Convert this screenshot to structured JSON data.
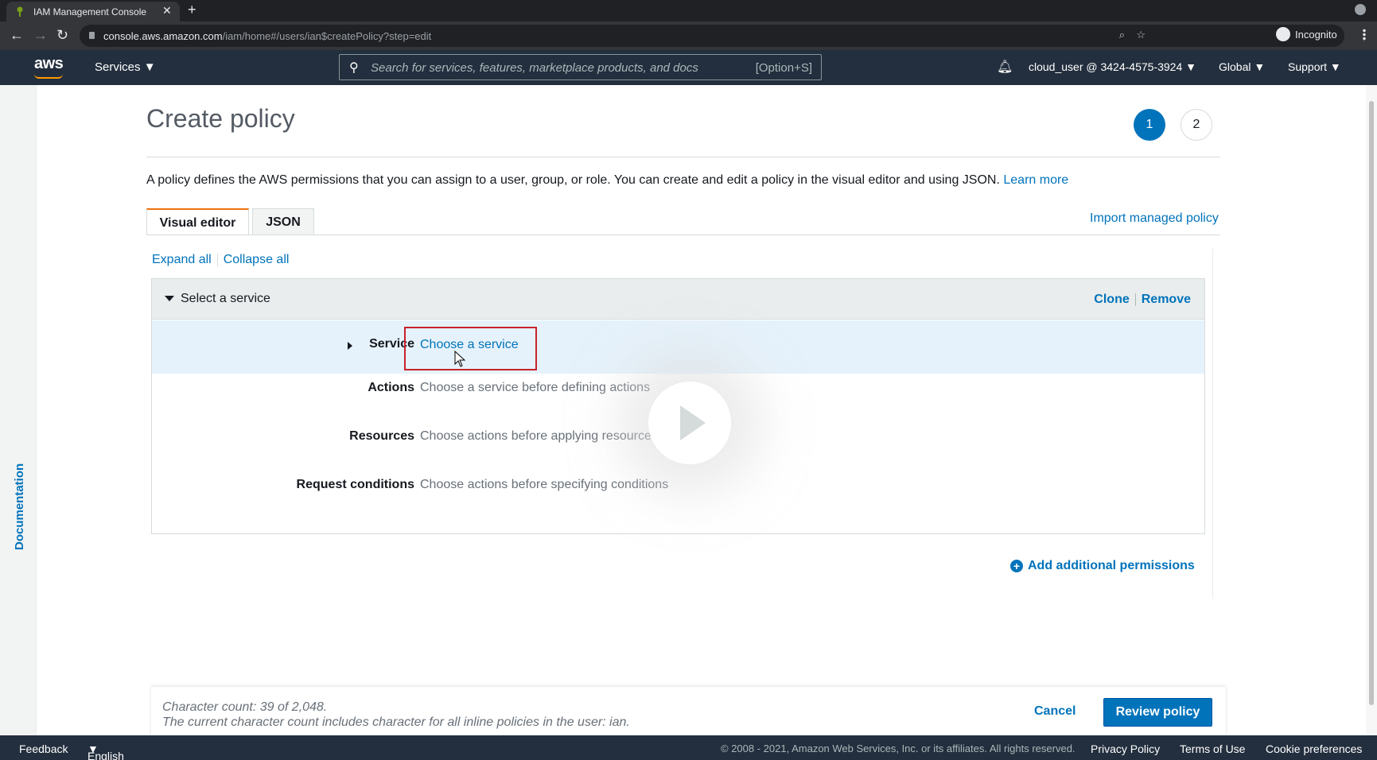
{
  "browser": {
    "tab_title": "IAM Management Console",
    "url_host": "console.aws.amazon.com",
    "url_path": "/iam/home#/users/ian$createPolicy?step=edit",
    "profile_label": "Incognito"
  },
  "aws_header": {
    "logo": "aws",
    "services_label": "Services",
    "search_placeholder": "Search for services, features, marketplace products, and docs",
    "search_shortcut": "[Option+S]",
    "account": "cloud_user @ 3424-4575-3924",
    "region": "Global",
    "support": "Support"
  },
  "doc_rail": {
    "label": "Documentation"
  },
  "page": {
    "title": "Create policy",
    "steps": [
      "1",
      "2"
    ],
    "intro": "A policy defines the AWS permissions that you can assign to a user, group, or role. You can create and edit a policy in the visual editor and using JSON.",
    "learn_more": "Learn more",
    "tabs": [
      "Visual editor",
      "JSON"
    ],
    "import_label": "Import managed policy",
    "expand_all": "Expand all",
    "collapse_all": "Collapse all"
  },
  "statement": {
    "header": "Select a service",
    "clone": "Clone",
    "remove": "Remove",
    "rows": [
      {
        "label": "Service",
        "value": "Choose a service"
      },
      {
        "label": "Actions",
        "value": "Choose a service before defining actions"
      },
      {
        "label": "Resources",
        "value": "Choose actions before applying resources"
      },
      {
        "label": "Request conditions",
        "value": "Choose actions before specifying conditions"
      }
    ]
  },
  "add_permissions": "Add additional permissions",
  "footer_bar": {
    "char_count": "Character count: 39 of 2,048.",
    "char_note": "The current character count includes character for all inline policies in the user: ian.",
    "cancel": "Cancel",
    "review": "Review policy"
  },
  "console_footer": {
    "feedback": "Feedback",
    "language": "English (US)",
    "copyright": "© 2008 - 2021, Amazon Web Services, Inc. or its affiliates. All rights reserved.",
    "privacy": "Privacy Policy",
    "terms": "Terms of Use",
    "cookies": "Cookie preferences"
  },
  "colors": {
    "aws_nav": "#232f3e",
    "link": "#0073bb",
    "accent_orange": "#ec7211",
    "highlight_box": "#c7222a"
  }
}
